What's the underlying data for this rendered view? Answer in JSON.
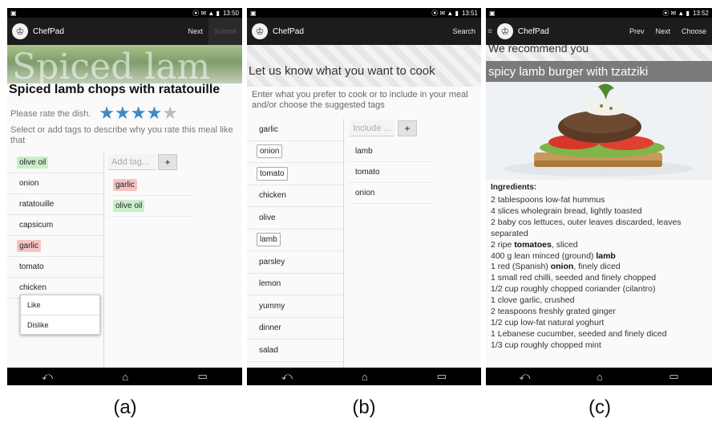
{
  "status": {
    "time_a": "13:50",
    "time_b": "13:51",
    "time_c": "13:52"
  },
  "app": {
    "name": "ChefPad"
  },
  "screen_a": {
    "actions": [
      "Next",
      "Submit"
    ],
    "hero_text": "Spiced lam",
    "title": "Spiced lamb chops with ratatouille",
    "rate_label": "Please rate the dish.",
    "rating": 4,
    "rating_max": 5,
    "description": "Select or add tags to describe why you rate this meal like that",
    "tags": [
      {
        "label": "olive oil",
        "state": "like"
      },
      {
        "label": "onion",
        "state": ""
      },
      {
        "label": "ratatouille",
        "state": ""
      },
      {
        "label": "capsicum",
        "state": ""
      },
      {
        "label": "garlic",
        "state": "dislike"
      },
      {
        "label": "tomato",
        "state": ""
      },
      {
        "label": "chicken",
        "state": ""
      }
    ],
    "input_placeholder": "Add tag...",
    "plus_label": "+",
    "selected": [
      {
        "label": "garlic",
        "state": "dislike"
      },
      {
        "label": "olive oil",
        "state": "like"
      }
    ],
    "popup": [
      "Like",
      "Dislike"
    ]
  },
  "screen_b": {
    "actions": [
      "Search"
    ],
    "title": "Let us know what you want to cook",
    "description": "Enter what you prefer to cook or to include in your meal and/or choose the suggested tags",
    "tags": [
      {
        "label": "garlic",
        "boxed": false
      },
      {
        "label": "onion",
        "boxed": true
      },
      {
        "label": "tomato",
        "boxed": true
      },
      {
        "label": "chicken",
        "boxed": false
      },
      {
        "label": "olive",
        "boxed": false
      },
      {
        "label": "lamb",
        "boxed": true
      },
      {
        "label": "parsley",
        "boxed": false
      },
      {
        "label": "lemon",
        "boxed": false
      },
      {
        "label": "yummy",
        "boxed": false
      },
      {
        "label": "dinner",
        "boxed": false
      },
      {
        "label": "salad",
        "boxed": false
      }
    ],
    "input_placeholder": "Include ...",
    "plus_label": "+",
    "selected": [
      "lamb",
      "tomato",
      "onion"
    ]
  },
  "screen_c": {
    "actions": [
      "Prev",
      "Next",
      "Choose"
    ],
    "recommend": "We recommend you",
    "recipe_title": "spicy lamb burger with tzatziki",
    "ingredients_heading": "Ingredients:",
    "ingredients": [
      "2 tablespoons low-fat hummus",
      "4 slices wholegrain bread, lightly toasted",
      "2 baby cos lettuces, outer leaves discarded, leaves separated",
      [
        "2 ripe ",
        "tomatoes",
        ", sliced"
      ],
      [
        "400 g lean minced (ground) ",
        "lamb",
        ""
      ],
      [
        "1 red (Spanish) ",
        "onion",
        ", finely diced"
      ],
      "1 small red chilli, seeded and finely chopped",
      "1/2 cup roughly chopped coriander (cilantro)",
      "1 clove garlic, crushed",
      "2 teaspoons freshly grated ginger",
      "1/2 cup low-fat natural yoghurt",
      "1 Lebanese cucumber, seeded and finely diced",
      "1/3 cup roughly chopped mint"
    ]
  },
  "nav": {
    "back": "⤺",
    "home": "⌂",
    "recent": "▭"
  },
  "captions": [
    "(a)",
    "(b)",
    "(c)"
  ]
}
